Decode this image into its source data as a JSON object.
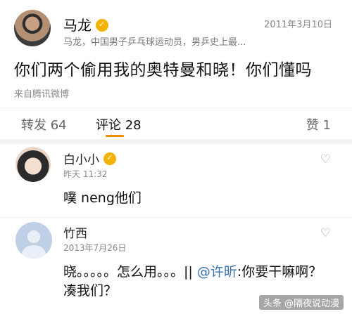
{
  "post": {
    "author": "马龙",
    "date": "2011年3月10日",
    "description": "马龙，中国男子乒乓球运动员，男乒史上最...",
    "content": "你们两个偷用我的奥特曼和晓！你们懂吗",
    "source": "来自腾讯微博"
  },
  "tabs": {
    "repost": "转发 64",
    "comments": "评论 28",
    "likes": "赞 1"
  },
  "comments": [
    {
      "name": "白小小",
      "time": "昨天 11:32",
      "text": "噗 neng他们",
      "verified": true
    },
    {
      "name": "竹西",
      "time": "2013年7月26日",
      "text_prefix": "晓。。。。。怎么用。。。||",
      "mention": "@许昕",
      "text_suffix": ":你要干嘛啊？凑我们？",
      "verified": false
    }
  ],
  "watermark": "头条 @隔夜说动漫",
  "colors": {
    "accent": "#f08c00",
    "badge": "#f3b300",
    "mention": "#3a6fb0"
  },
  "icons": {
    "verified": "verified-badge-icon",
    "like": "heart-outline-icon"
  }
}
